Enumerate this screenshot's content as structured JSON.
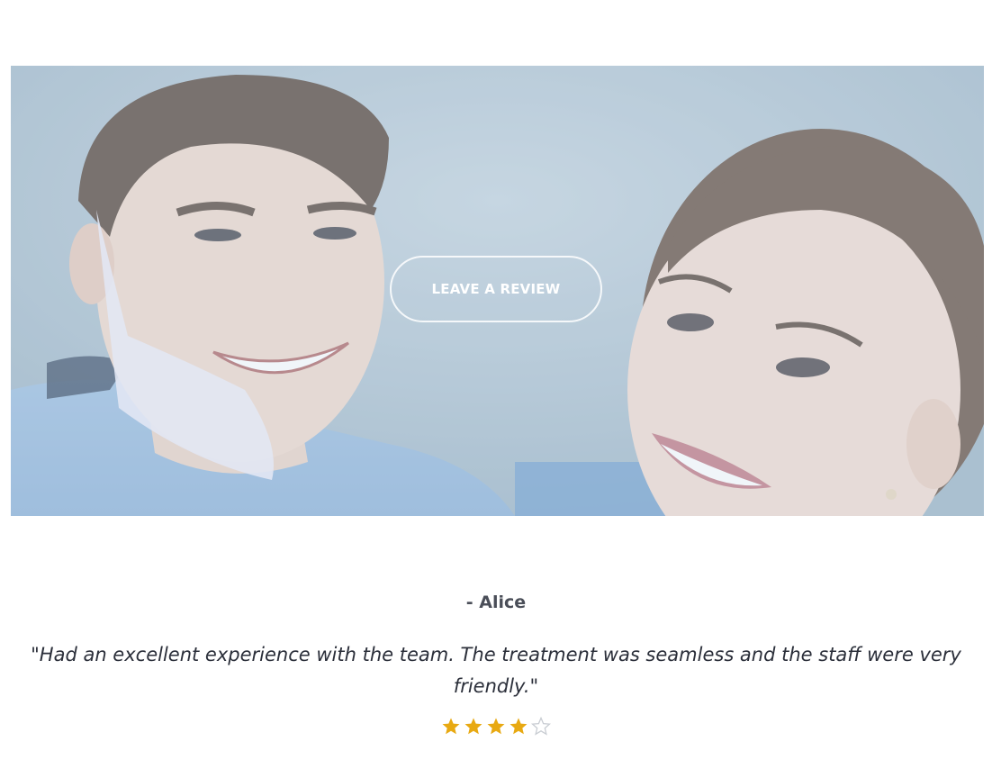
{
  "hero": {
    "button_label": "LEAVE A REVIEW"
  },
  "testimonial": {
    "author": "- Alice",
    "quote_line1": "\"Had an excellent experience with the team. The treatment was seamless and the staff were very",
    "quote_line2": "friendly.\"",
    "rating": 4,
    "max_rating": 5
  },
  "colors": {
    "star_filled": "#e8a912",
    "star_empty": "#c8ccd2",
    "text_dark": "#2b2f3a",
    "author_text": "#4a4e58"
  }
}
